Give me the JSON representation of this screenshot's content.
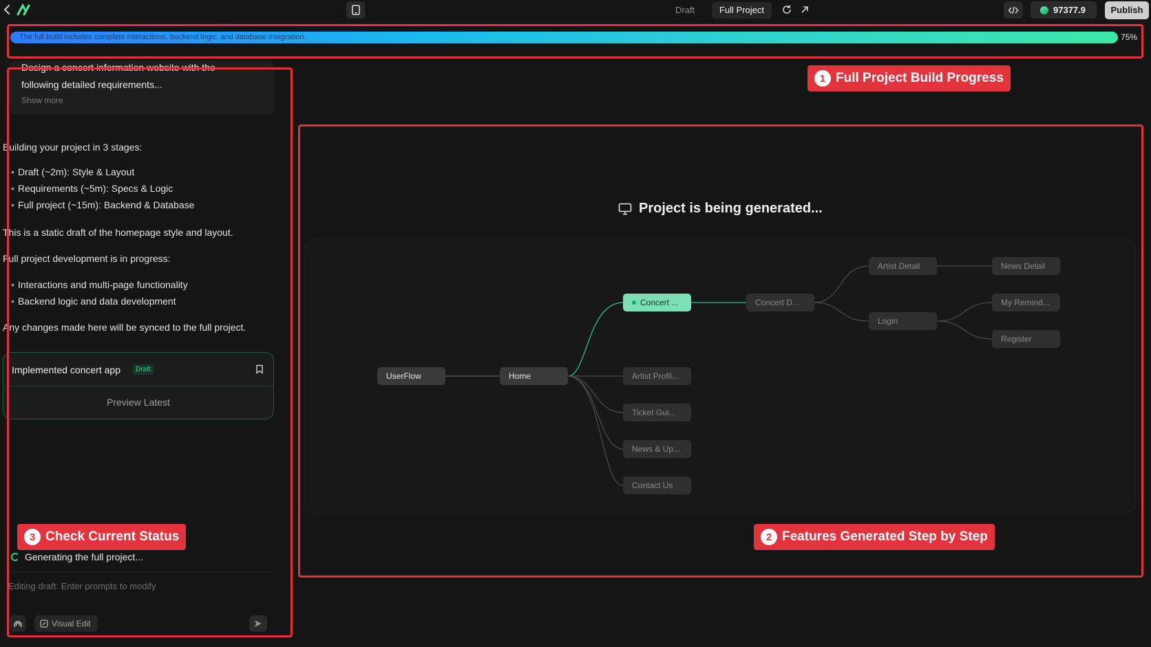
{
  "topbar": {
    "tabs": [
      {
        "label": "Draft"
      },
      {
        "label": "Full Project"
      }
    ],
    "credits": "97377.9",
    "publish_label": "Publish"
  },
  "progress": {
    "text": "The full build includes complete interactions, backend logic, and database integration.",
    "percent_label": "75%",
    "value": 0.75,
    "colors": {
      "start": "#2d7cff",
      "end": "#3be8a8"
    }
  },
  "sidebar": {
    "prompt_text": "Design a concert information website with the following detailed requirements...",
    "show_more": "Show more",
    "messages": {
      "intro": "Building your project in 3 stages:",
      "stages": [
        "Draft (~2m): Style & Layout",
        "Requirements (~5m): Specs & Logic",
        "Full project (~15m): Backend & Database"
      ],
      "static_note": "This is a static draft of the homepage style and layout.",
      "progress_note": "Full project development is in progress:",
      "progress_items": [
        "Interactions and multi-page functionality",
        "Backend logic and data development"
      ],
      "sync_note": "Any changes made here will be synced to the full project."
    },
    "app_card": {
      "title": "Implemented concert app",
      "badge": "Draft",
      "preview_label": "Preview Latest"
    },
    "status": "Generating the full project...",
    "input_placeholder": "Editing draft: Enter prompts to modify",
    "visual_edit_label": "Visual Edit"
  },
  "main": {
    "title": "Project is being generated...",
    "flow_nodes": [
      {
        "label": "UserFlow",
        "state": "active"
      },
      {
        "label": "Home",
        "state": "active"
      },
      {
        "label": "Concert ...",
        "state": "current"
      },
      {
        "label": "Artist Profil...",
        "state": "pending"
      },
      {
        "label": "Ticket Gui...",
        "state": "pending"
      },
      {
        "label": "News & Up...",
        "state": "pending"
      },
      {
        "label": "Contact Us",
        "state": "pending"
      },
      {
        "label": "Concert D...",
        "state": "pending"
      },
      {
        "label": "Artist Detail",
        "state": "pending"
      },
      {
        "label": "Login",
        "state": "pending"
      },
      {
        "label": "News Detail",
        "state": "pending"
      },
      {
        "label": "My Remind...",
        "state": "pending"
      },
      {
        "label": "Register",
        "state": "pending"
      }
    ]
  },
  "annotations": [
    {
      "number": "1",
      "label": "Full Project Build Progress"
    },
    {
      "number": "2",
      "label": "Features Generated Step by Step"
    },
    {
      "number": "3",
      "label": "Check Current Status"
    }
  ],
  "colors": {
    "accent": "#2ed187",
    "annotation": "#e3303b",
    "background": "#151515"
  }
}
